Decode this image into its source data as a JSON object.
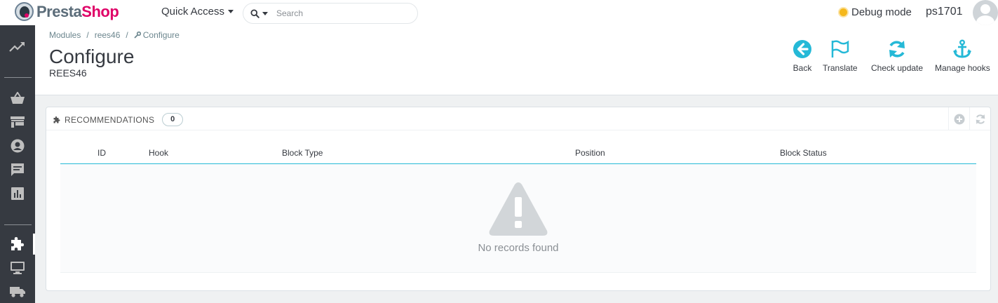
{
  "header": {
    "logo_left": "Presta",
    "logo_right": "Shop",
    "quick_access": "Quick Access",
    "search_placeholder": "Search",
    "debug_label": "Debug mode",
    "shop_name": "ps1701",
    "debug_color": "#f5b81c"
  },
  "breadcrumb": {
    "items": [
      "Modules",
      "rees46",
      "Configure"
    ]
  },
  "page": {
    "title": "Configure",
    "subtitle": "REES46"
  },
  "toolbar": {
    "back": "Back",
    "translate": "Translate",
    "check_update": "Check update",
    "manage_hooks": "Manage hooks",
    "accent": "#25b9d7"
  },
  "panel": {
    "title": "RECOMMENDATIONS",
    "count": "0",
    "columns": [
      "ID",
      "Hook",
      "Block Type",
      "Position",
      "Block Status"
    ],
    "empty_text": "No records found"
  },
  "sidebar": {
    "icons": [
      "stats-trend-icon",
      "orders-basket-icon",
      "catalog-store-icon",
      "customers-icon",
      "messages-icon",
      "stats-bar-icon",
      "modules-puzzle-icon",
      "design-monitor-icon",
      "shipping-truck-icon"
    ]
  }
}
